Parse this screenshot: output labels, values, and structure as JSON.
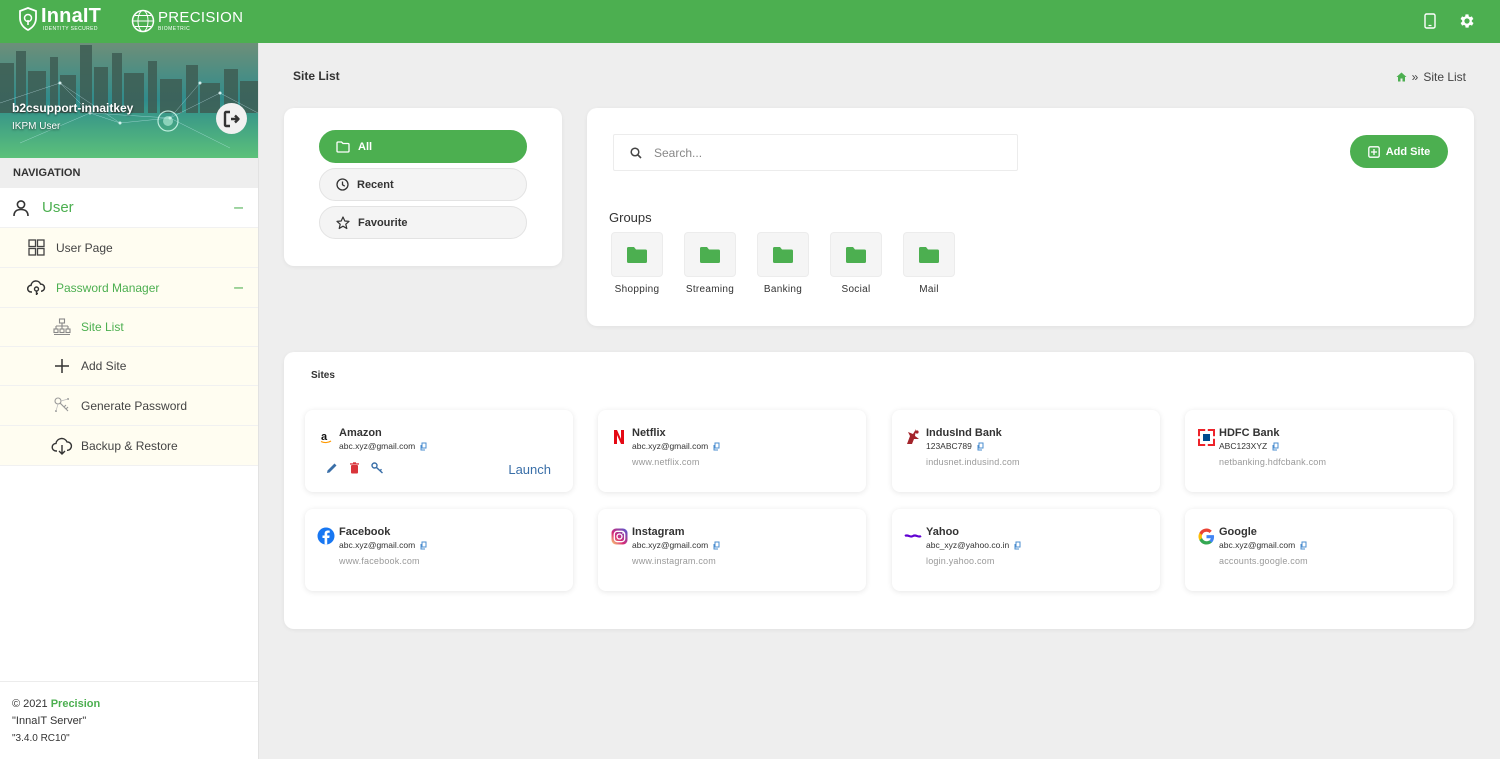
{
  "topbar": {
    "brand": "InnaIT",
    "brand_tagline": "IDENTITY SECURED",
    "partner": "PRECISION",
    "partner_tagline": "BIOMETRIC"
  },
  "profile": {
    "username": "b2csupport-innaitkey",
    "role": "IKPM User"
  },
  "nav": {
    "heading": "NAVIGATION",
    "user": "User",
    "user_page": "User Page",
    "password_manager": "Password Manager",
    "site_list": "Site List",
    "add_site": "Add Site",
    "generate_password": "Generate Password",
    "backup_restore": "Backup & Restore"
  },
  "footer": {
    "copyright": "© 2021",
    "company": "Precision",
    "server": "\"InnaIT Server\"",
    "version": "\"3.4.0 RC10\""
  },
  "page": {
    "title": "Site List",
    "breadcrumb_sep": "»",
    "breadcrumb_current": "Site List"
  },
  "filters": {
    "all": "All",
    "recent": "Recent",
    "favourite": "Favourite"
  },
  "search": {
    "placeholder": "Search..."
  },
  "add_site_button": "Add Site",
  "groups": {
    "title": "Groups",
    "items": [
      "Shopping",
      "Streaming",
      "Banking",
      "Social",
      "Mail"
    ]
  },
  "sites": {
    "title": "Sites",
    "launch_label": "Launch",
    "items": [
      {
        "name": "Amazon",
        "user": "abc.xyz@gmail.com",
        "url": ""
      },
      {
        "name": "Netflix",
        "user": "abc.xyz@gmail.com",
        "url": "www.netflix.com"
      },
      {
        "name": "IndusInd Bank",
        "user": "123ABC789",
        "url": "indusnet.indusind.com"
      },
      {
        "name": "HDFC Bank",
        "user": "ABC123XYZ",
        "url": "netbanking.hdfcbank.com"
      },
      {
        "name": "Facebook",
        "user": "abc.xyz@gmail.com",
        "url": "www.facebook.com"
      },
      {
        "name": "Instagram",
        "user": "abc.xyz@gmail.com",
        "url": "www.instagram.com"
      },
      {
        "name": "Yahoo",
        "user": "abc_xyz@yahoo.co.in",
        "url": "login.yahoo.com"
      },
      {
        "name": "Google",
        "user": "abc.xyz@gmail.com",
        "url": "accounts.google.com"
      }
    ]
  },
  "colors": {
    "accent": "#4caf50",
    "link": "#3a6fa8"
  }
}
